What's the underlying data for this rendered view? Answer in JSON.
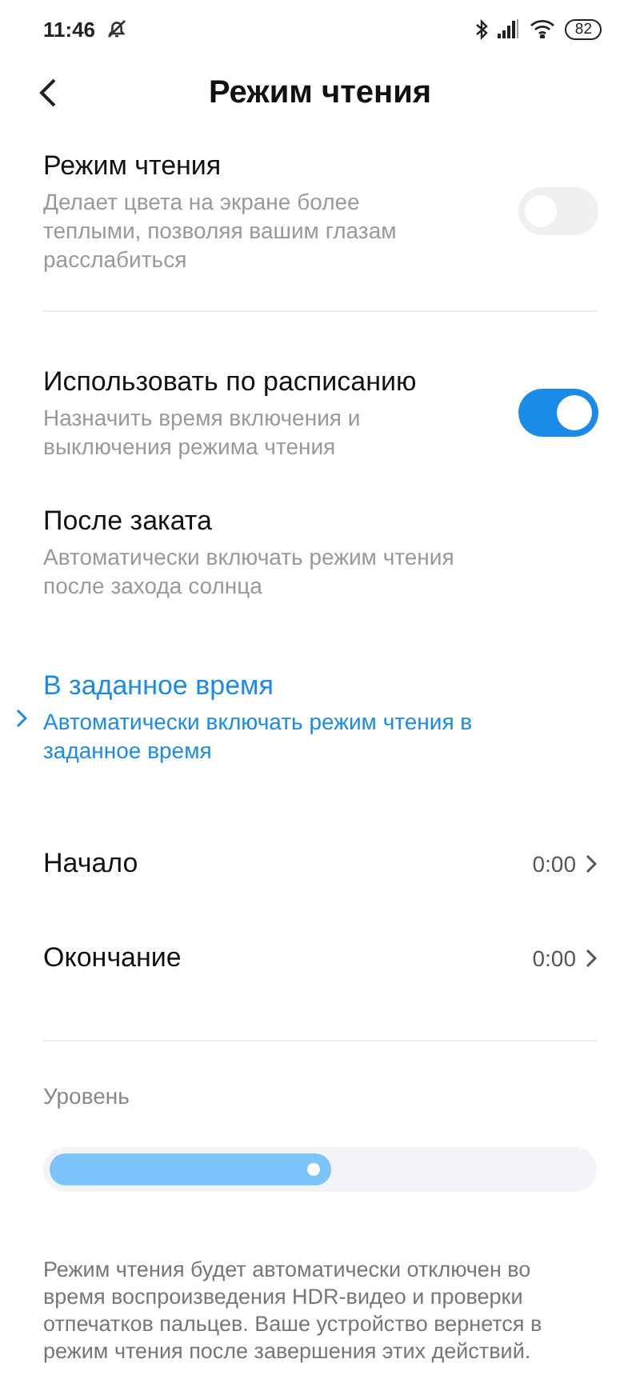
{
  "status_bar": {
    "time": "11:46",
    "battery": "82"
  },
  "header": {
    "title": "Режим чтения"
  },
  "reading_mode": {
    "title": "Режим чтения",
    "subtitle": "Делает цвета на экране более теплыми, позволяя вашим глазам расслабиться",
    "on": false
  },
  "schedule": {
    "title": "Использовать по расписанию",
    "subtitle": "Назначить время включения и выключения режима чтения",
    "on": true
  },
  "schedule_options": [
    {
      "title": "После заката",
      "subtitle": "Автоматически включать режим чтения после захода солнца",
      "selected": false
    },
    {
      "title": "В заданное время",
      "subtitle": "Автоматически включать режим чтения в заданное время",
      "selected": true
    }
  ],
  "times": [
    {
      "label": "Начало",
      "value": "0:00"
    },
    {
      "label": "Окончание",
      "value": "0:00"
    }
  ],
  "level": {
    "label": "Уровень",
    "level": 0.52
  },
  "note": "Режим чтения будет автоматически отключен во время воспроизведения HDR-видео и проверки отпечатков пальцев. Ваше устройство вернется в режим чтения после завершения этих действий."
}
